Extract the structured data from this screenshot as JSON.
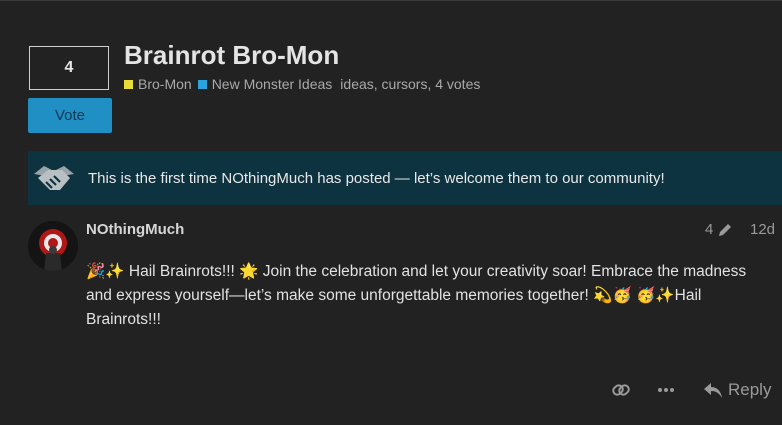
{
  "topic": {
    "title": "Brainrot Bro-Mon",
    "vote_count": "4",
    "vote_label": "Vote",
    "categories": [
      {
        "name": "Bro-Mon",
        "color": "#e8dc3a"
      },
      {
        "name": "New Monster Ideas",
        "color": "#2ba3dc"
      }
    ],
    "tags": "ideas, cursors, 4 votes"
  },
  "welcome": {
    "message": "This is the first time NOthingMuch has posted — let’s welcome them to our community!",
    "icon": "handshake-icon"
  },
  "post": {
    "username": "NOthingMuch",
    "edit_count": "4",
    "date": "12d",
    "body": "🎉✨ Hail Brainrots!!! 🌟 Join the celebration and let your creativity soar! Embrace the madness and express yourself—let’s make some unforgettable memories together! 💫🥳 🥳✨Hail Brainrots!!!"
  },
  "actions": {
    "reply_label": "Reply",
    "icons": [
      "link-icon",
      "more-icon",
      "reply-icon"
    ]
  }
}
